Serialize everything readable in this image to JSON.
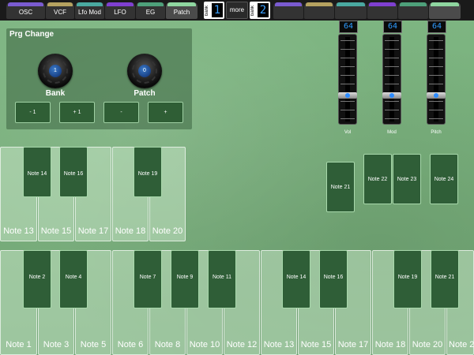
{
  "tabs": [
    {
      "label": "OSC",
      "color": "#7a5bd0"
    },
    {
      "label": "VCF",
      "color": "#b5a260"
    },
    {
      "label": "Lfo Mod",
      "color": "#4aa9a0"
    },
    {
      "label": "LFO",
      "color": "#7f3fd0"
    },
    {
      "label": "EG",
      "color": "#4ea07a"
    },
    {
      "label": "Patch",
      "color": "#8fd6a0"
    }
  ],
  "right_slot_colors": [
    "#7a5bd0",
    "#b5a260",
    "#4aa9a0",
    "#7f3fd0",
    "#4ea07a",
    "#8fd6a0"
  ],
  "bank_left": {
    "label": "bank",
    "value": "1"
  },
  "more": "more",
  "bank_right": {
    "label": "bank",
    "value": "2"
  },
  "prg": {
    "title": "Prg Change",
    "bank_label": "Bank",
    "bank_value": "1",
    "patch_label": "Patch",
    "patch_value": "0",
    "buttons": [
      "- 1",
      "+ 1",
      "-",
      "+"
    ]
  },
  "faders": [
    {
      "label": "Vol",
      "value": "64",
      "level": 0.5
    },
    {
      "label": "Mod",
      "value": "64",
      "level": 0.5
    },
    {
      "label": "Pitch",
      "value": "64",
      "level": 0.5
    }
  ],
  "upper_white": [
    "Note 13",
    "Note 15",
    "Note 17",
    "Note 18",
    "Note 20"
  ],
  "upper_black": [
    "Note 14",
    "Note 16",
    "Note 19"
  ],
  "pads": [
    "Note 21",
    "Note 22",
    "Note 23",
    "Note 24"
  ],
  "lower_white": [
    "Note 1",
    "Note 3",
    "Note 5",
    "Note 6",
    "Note 8",
    "Note 10",
    "Note 12",
    "Note 13",
    "Note 15",
    "Note 17",
    "Note 18",
    "Note 20",
    "Note 2"
  ],
  "lower_black": [
    "Note 2",
    "Note 4",
    "Note 7",
    "Note 9",
    "Note 11",
    "Note 14",
    "Note 16",
    "Note 19",
    "Note 21"
  ]
}
